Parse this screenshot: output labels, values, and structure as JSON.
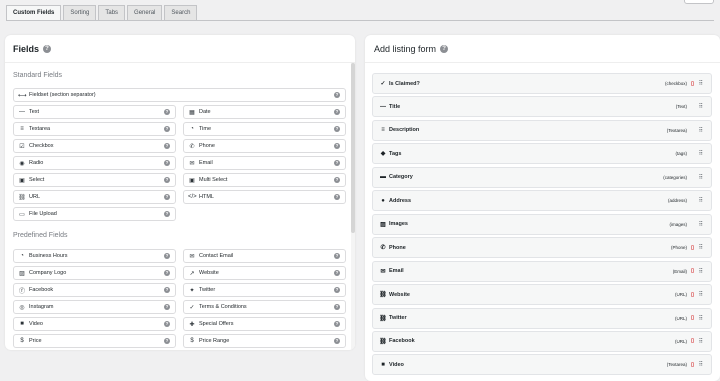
{
  "tabs": [
    {
      "label": "Custom Fields",
      "active": true
    },
    {
      "label": "Sorting"
    },
    {
      "label": "Tabs"
    },
    {
      "label": "General"
    },
    {
      "label": "Search"
    }
  ],
  "left": {
    "title": "Fields",
    "standard_title": "Standard Fields",
    "predefined_title": "Predefined Fields",
    "fieldset": {
      "label": "Fieldset (section separator)",
      "icon": "arrows-icon"
    },
    "standard": [
      {
        "label": "Text",
        "icon": "minus-icon"
      },
      {
        "label": "Date",
        "icon": "calendar-icon"
      },
      {
        "label": "Textarea",
        "icon": "lines-icon"
      },
      {
        "label": "Time",
        "icon": "clock-icon"
      },
      {
        "label": "Checkbox",
        "icon": "checkbox-icon"
      },
      {
        "label": "Phone",
        "icon": "phone-icon"
      },
      {
        "label": "Radio",
        "icon": "radio-icon"
      },
      {
        "label": "Email",
        "icon": "envelope-icon"
      },
      {
        "label": "Select",
        "icon": "select-icon"
      },
      {
        "label": "Multi Select",
        "icon": "multiselect-icon"
      },
      {
        "label": "URL",
        "icon": "link-icon"
      },
      {
        "label": "HTML",
        "icon": "code-icon"
      },
      {
        "label": "File Upload",
        "icon": "file-icon"
      }
    ],
    "predefined": [
      {
        "label": "Business Hours",
        "icon": "clock-icon"
      },
      {
        "label": "Contact Email",
        "icon": "envelope-icon"
      },
      {
        "label": "Company Logo",
        "icon": "image-icon"
      },
      {
        "label": "Website",
        "icon": "external-link-icon"
      },
      {
        "label": "Facebook",
        "icon": "facebook-icon"
      },
      {
        "label": "Twitter",
        "icon": "twitter-icon"
      },
      {
        "label": "Instagram",
        "icon": "instagram-icon"
      },
      {
        "label": "Terms & Conditions",
        "icon": "check-square-icon"
      },
      {
        "label": "Video",
        "icon": "video-icon"
      },
      {
        "label": "Special Offers",
        "icon": "gift-icon"
      },
      {
        "label": "Price",
        "icon": "dollar-icon"
      },
      {
        "label": "Price Range",
        "icon": "dollar-icon"
      }
    ]
  },
  "right": {
    "title": "Add listing form",
    "rows": [
      {
        "label": "Is Claimed?",
        "type": "(checkbox)",
        "icon": "user-check-icon",
        "deletable": true
      },
      {
        "label": "Title",
        "type": "(Text)",
        "icon": "minus-icon",
        "deletable": false
      },
      {
        "label": "Description",
        "type": "(Textarea)",
        "icon": "lines-icon",
        "deletable": false
      },
      {
        "label": "Tags",
        "type": "(tags)",
        "icon": "tag-icon",
        "deletable": false
      },
      {
        "label": "Category",
        "type": "(categories)",
        "icon": "folder-icon",
        "deletable": false
      },
      {
        "label": "Address",
        "type": "(address)",
        "icon": "pin-icon",
        "deletable": false
      },
      {
        "label": "Images",
        "type": "(images)",
        "icon": "image-icon",
        "deletable": false
      },
      {
        "label": "Phone",
        "type": "(Phone)",
        "icon": "phone-icon",
        "deletable": true
      },
      {
        "label": "Email",
        "type": "(Email)",
        "icon": "envelope-icon",
        "deletable": true
      },
      {
        "label": "Website",
        "type": "(URL)",
        "icon": "link-icon",
        "deletable": true
      },
      {
        "label": "Twitter",
        "type": "(URL)",
        "icon": "link-icon",
        "deletable": true
      },
      {
        "label": "Facebook",
        "type": "(URL)",
        "icon": "link-icon",
        "deletable": true
      },
      {
        "label": "Video",
        "type": "(Textarea)",
        "icon": "video-icon",
        "deletable": true
      }
    ]
  },
  "glyphs": {
    "arrows-icon": "⟷",
    "minus-icon": "—",
    "calendar-icon": "▦",
    "lines-icon": "≡",
    "clock-icon": "◔",
    "checkbox-icon": "☑",
    "phone-icon": "✆",
    "radio-icon": "◉",
    "envelope-icon": "✉",
    "select-icon": "▣",
    "multiselect-icon": "▣",
    "link-icon": "⛓",
    "code-icon": "</>",
    "file-icon": "▭",
    "image-icon": "▨",
    "external-link-icon": "↗",
    "facebook-icon": "ⓕ",
    "twitter-icon": "✦",
    "instagram-icon": "◎",
    "check-square-icon": "✓",
    "video-icon": "■",
    "gift-icon": "✚",
    "dollar-icon": "$",
    "user-check-icon": "✓",
    "tag-icon": "◆",
    "folder-icon": "▬",
    "pin-icon": "●",
    "trash-icon": "🗑",
    "drag-icon": "⠿"
  }
}
